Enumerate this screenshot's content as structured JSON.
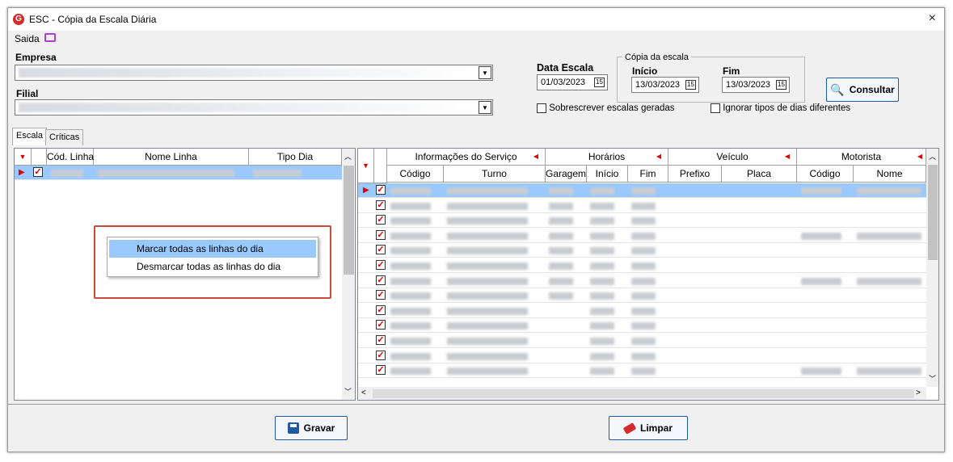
{
  "window": {
    "title": "ESC - Cópia da Escala Diária",
    "close_glyph": "×",
    "app_icon_letter": "G"
  },
  "saida": {
    "label": "Saida"
  },
  "empresa": {
    "label": "Empresa"
  },
  "filial": {
    "label": "Filial"
  },
  "data_escala": {
    "label": "Data Escala",
    "value": "01/03/2023"
  },
  "copia": {
    "group_label": "Cópia da escala",
    "inicio_label": "Início",
    "inicio_value": "13/03/2023",
    "fim_label": "Fim",
    "fim_value": "13/03/2023"
  },
  "consultar": {
    "label": "Consultar"
  },
  "options": {
    "sobrescrever": "Sobrescrever escalas geradas",
    "ignorar": "Ignorar tipos de dias diferentes"
  },
  "tabs": [
    "Escala",
    "Críticas"
  ],
  "left_grid": {
    "headers": [
      "Cód. Linha",
      "Nome Linha",
      "Tipo Dia"
    ]
  },
  "right_grid": {
    "group_headers": [
      "Informações do Serviço",
      "Horários",
      "Veículo",
      "Motorista"
    ],
    "headers": [
      "Código",
      "Turno",
      "Garagem",
      "Início",
      "Fim",
      "Prefixo",
      "Placa",
      "Código",
      "Nome"
    ]
  },
  "context_menu": {
    "items": [
      "Marcar todas as linhas do dia",
      "Desmarcar todas as linhas do dia"
    ]
  },
  "buttons": {
    "gravar": "Gravar",
    "limpar": "Limpar"
  },
  "colors": {
    "accent": "#1f5aa6",
    "check": "#d00000",
    "highlight": "#99c9ff"
  }
}
